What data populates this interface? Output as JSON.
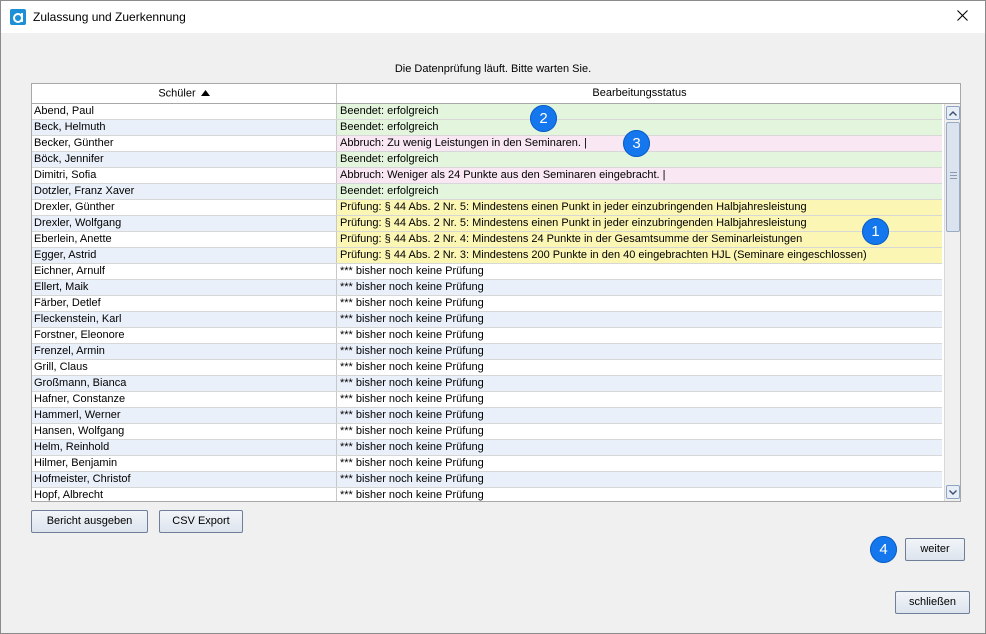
{
  "window": {
    "title": "Zulassung und Zuerkennung"
  },
  "status_message": "Die Datenprüfung läuft. Bitte warten Sie.",
  "table": {
    "columns": [
      "Schüler",
      "Bearbeitungsstatus"
    ],
    "rows": [
      {
        "name": "Abend, Paul",
        "status": "Beendet: erfolgreich",
        "kind": "ok"
      },
      {
        "name": "Beck, Helmuth",
        "status": "Beendet: erfolgreich",
        "kind": "ok"
      },
      {
        "name": "Becker, Günther",
        "status": "Abbruch: Zu wenig Leistungen in den Seminaren. |",
        "kind": "err"
      },
      {
        "name": "Böck, Jennifer",
        "status": "Beendet: erfolgreich",
        "kind": "ok"
      },
      {
        "name": "Dimitri, Sofia",
        "status": "Abbruch: Weniger als 24 Punkte aus den Seminaren eingebracht. |",
        "kind": "err"
      },
      {
        "name": "Dotzler, Franz Xaver",
        "status": "Beendet: erfolgreich",
        "kind": "ok"
      },
      {
        "name": "Drexler, Günther",
        "status": "Prüfung: § 44 Abs. 2 Nr. 5: Mindestens einen Punkt in jeder einzubringenden Halbjahresleistung",
        "kind": "warn"
      },
      {
        "name": "Drexler, Wolfgang",
        "status": "Prüfung: § 44 Abs. 2 Nr. 5: Mindestens einen Punkt in jeder einzubringenden Halbjahresleistung",
        "kind": "warn"
      },
      {
        "name": "Eberlein, Anette",
        "status": "Prüfung: § 44 Abs. 2 Nr. 4: Mindestens 24 Punkte in der Gesamtsumme der Seminarleistungen",
        "kind": "warn"
      },
      {
        "name": "Egger, Astrid",
        "status": "Prüfung: § 44 Abs. 2 Nr. 3: Mindestens 200 Punkte in den 40 eingebrachten HJL (Seminare eingeschlossen)",
        "kind": "warn"
      },
      {
        "name": "Eichner, Arnulf",
        "status": "*** bisher noch keine Prüfung",
        "kind": "none"
      },
      {
        "name": "Ellert, Maik",
        "status": "*** bisher noch keine Prüfung",
        "kind": "none"
      },
      {
        "name": "Färber, Detlef",
        "status": "*** bisher noch keine Prüfung",
        "kind": "none"
      },
      {
        "name": "Fleckenstein, Karl",
        "status": "*** bisher noch keine Prüfung",
        "kind": "none"
      },
      {
        "name": "Forstner, Eleonore",
        "status": "*** bisher noch keine Prüfung",
        "kind": "none"
      },
      {
        "name": "Frenzel, Armin",
        "status": "*** bisher noch keine Prüfung",
        "kind": "none"
      },
      {
        "name": "Grill, Claus",
        "status": "*** bisher noch keine Prüfung",
        "kind": "none"
      },
      {
        "name": "Großmann, Bianca",
        "status": "*** bisher noch keine Prüfung",
        "kind": "none"
      },
      {
        "name": "Hafner, Constanze",
        "status": "*** bisher noch keine Prüfung",
        "kind": "none"
      },
      {
        "name": "Hammerl, Werner",
        "status": "*** bisher noch keine Prüfung",
        "kind": "none"
      },
      {
        "name": "Hansen, Wolfgang",
        "status": "*** bisher noch keine Prüfung",
        "kind": "none"
      },
      {
        "name": "Helm, Reinhold",
        "status": "*** bisher noch keine Prüfung",
        "kind": "none"
      },
      {
        "name": "Hilmer, Benjamin",
        "status": "*** bisher noch keine Prüfung",
        "kind": "none"
      },
      {
        "name": "Hofmeister, Christof",
        "status": "*** bisher noch keine Prüfung",
        "kind": "none"
      },
      {
        "name": "Hopf, Albrecht",
        "status": "*** bisher noch keine Prüfung",
        "kind": "none"
      }
    ]
  },
  "buttons": {
    "report": "Bericht ausgeben",
    "csv": "CSV Export",
    "next": "weiter",
    "close": "schließen"
  },
  "markers": [
    "1",
    "2",
    "3",
    "4"
  ],
  "icons": {
    "app": "app-logo-icon",
    "close": "close-icon",
    "sort": "sort-ascending-icon"
  },
  "colors": {
    "success_bg": "#e3f5dc",
    "abort_bg": "#f9e7f3",
    "check_bg": "#fbf6b4",
    "marker": "#1477ee"
  }
}
